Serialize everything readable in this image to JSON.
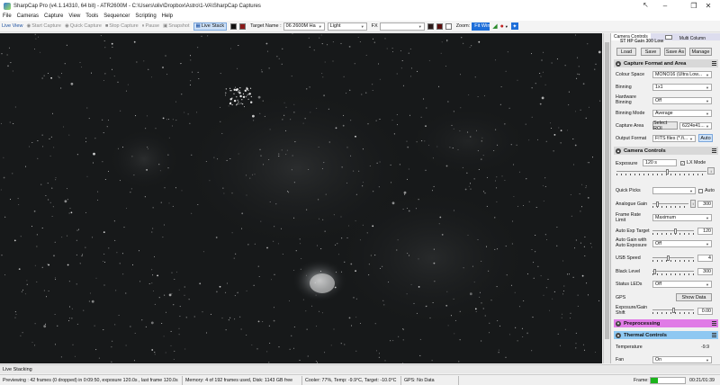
{
  "window": {
    "title": "SharpCap Pro (v4.1.14310, 64 bit) - ATR2600M - C:\\Users\\oliv\\Dropbox\\Astro\\1-VA\\SharpCap Captures",
    "minimize": "–",
    "maximize": "❐",
    "close": "✕"
  },
  "menu": [
    "File",
    "Cameras",
    "Capture",
    "View",
    "Tools",
    "Sequencer",
    "Scripting",
    "Help"
  ],
  "toolbar": {
    "live_view": "Live View",
    "start_capture": "Start Capture",
    "quick_capture": "Quick Capture",
    "stop_capture": "Stop Capture",
    "pause": "Pause",
    "snapshot": "Snapshot",
    "live_stack": "Live Stack",
    "target_label": "Target Name :",
    "target_value": "06 2600M Ha",
    "frame_type": "Light",
    "fx_label": "FX",
    "zoom_label": "Zoom:",
    "zoom_value": "Fit Win"
  },
  "panel": {
    "tab_camera_controls": "Camera Controls",
    "tab_multi_column": "Multi Column",
    "profile_header": "ST HP Gain 300 Low",
    "load": "Load",
    "save": "Save",
    "save_as": "Save As",
    "manage": "Manage",
    "capture_format_title": "Capture Format and Area",
    "colour_space_label": "Colour Space",
    "colour_space_value": "MONO16 (Ultra Low...",
    "binning_label": "Binning",
    "binning_value": "1x1",
    "hw_binning_label": "Hardware Binning",
    "hw_binning_value": "Off",
    "binning_mode_label": "Binning Mode",
    "binning_mode_value": "Average",
    "capture_area_label": "Capture Area",
    "select_roi": "Select ROI",
    "capture_area_value": "6224x41...",
    "output_format_label": "Output Format",
    "output_format_value": "FITS files (*.fi...",
    "auto": "Auto",
    "camera_controls_title": "Camera Controls",
    "exposure_label": "Exposure",
    "exposure_value": "120 s",
    "lx_mode": "LX Mode",
    "quick_picks_label": "Quick Picks",
    "quick_picks_auto": "Auto",
    "analogue_gain_label": "Analogue Gain",
    "analogue_gain_value": "300",
    "frame_rate_limit_label": "Frame Rate Limit",
    "frame_rate_limit_value": "Maximum",
    "auto_exp_target_label": "Auto Exp Target",
    "auto_exp_target_value": "120",
    "auto_gain_label": "Auto Gain with Auto Exposure",
    "auto_gain_value": "Off",
    "usb_speed_label": "USB Speed",
    "usb_speed_value": "4",
    "black_level_label": "Black Level",
    "black_level_value": "300",
    "status_leds_label": "Status LEDs",
    "status_leds_value": "Off",
    "gps_label": "GPS",
    "show_data": "Show Data",
    "exposure_gain_shift_label": "Exposure/Gain Shift",
    "exposure_gain_shift_value": "0.00",
    "preprocessing_title": "Preprocessing",
    "thermal_title": "Thermal Controls",
    "temperature_label": "Temperature",
    "temperature_value": "-9.9",
    "fan_label": "Fan",
    "fan_value": "On"
  },
  "status_top": "Live Stacking",
  "status": {
    "previewing": "Previewing : 42 frames (0 dropped) in 0:09:50, exposure 120.0s , last frame 120.0s",
    "memory": "Memory: 4 of 192 frames used, Disk: 1143 GB free",
    "cooler": "Cooler: 77%, Temp: -9.9°C, Target: -10.0°C",
    "gps": "GPS: No Data",
    "frame_label": "Frame:",
    "elapsed": "00:21/01:39"
  },
  "colors": {
    "preprocessing": "#e07be6",
    "thermal": "#8ec8f2",
    "capture_format": "#d8d8d8",
    "accent": "#1e6fd9"
  }
}
